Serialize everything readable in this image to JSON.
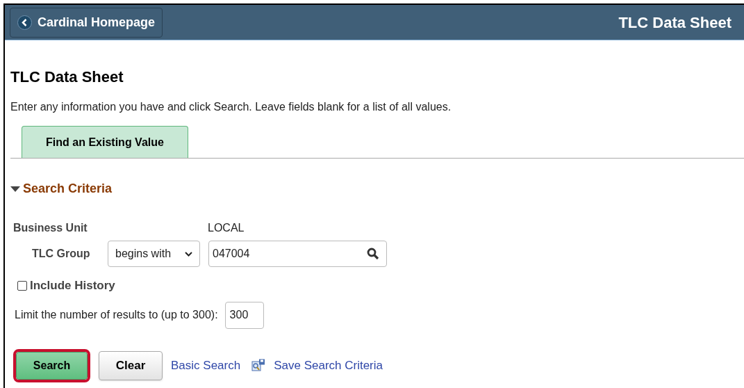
{
  "header": {
    "back_button": "Cardinal Homepage",
    "title": "TLC Data Sheet"
  },
  "page_title": "TLC Data Sheet",
  "instructions": "Enter any information you have and click Search. Leave fields blank for a list of all values.",
  "tabs": [
    {
      "label": "Find an Existing Value",
      "selected": true
    }
  ],
  "section": {
    "title": "Search Criteria",
    "expanded": true
  },
  "business_unit": {
    "label": "Business Unit",
    "value": "LOCAL"
  },
  "tlc_group": {
    "label": "TLC Group",
    "operator": "begins with",
    "value": "047004"
  },
  "include_history": {
    "label": "Include History",
    "checked": false
  },
  "limit": {
    "label": "Limit the number of results to (up to 300):",
    "value": "300"
  },
  "actions": [
    {
      "kind": "primary",
      "label": "Search",
      "highlighted": true
    },
    {
      "kind": "secondary",
      "label": "Clear",
      "highlighted": false
    },
    {
      "kind": "link",
      "label": "Basic Search",
      "highlighted": false
    },
    {
      "kind": "save-link",
      "label": "Save Search Criteria",
      "highlighted": false
    }
  ]
}
